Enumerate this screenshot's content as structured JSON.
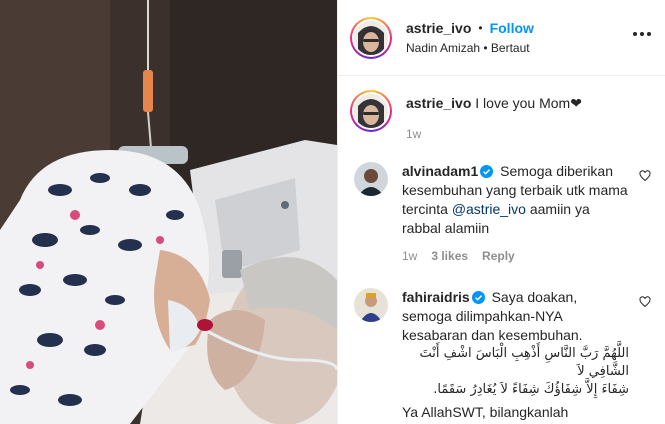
{
  "post": {
    "username": "astrie_ivo",
    "follow_label": "Follow",
    "audio": "Nadin Amizah • Bertaut",
    "caption": "I love you Mom❤",
    "caption_time": "1w"
  },
  "comments": [
    {
      "username": "alvinadam1",
      "text": "Semoga diberikan kesembuhan yang terbaik utk mama tercinta",
      "mention": "@astrie_ivo",
      "text_after": "aamiin ya rabbal alamiin",
      "time": "1w",
      "likes": "3 likes",
      "reply_label": "Reply"
    },
    {
      "username": "fahiraidris",
      "text": "Saya doakan, semoga dilimpahkan-NYA kesabaran dan kesembuhan.",
      "arabic_1": "اللَّهُمَّ رَبَّ النَّاسِ أَذْهِبِ الْبَاسَ اشْفِ أَنْتَ الشَّافِي لاَ",
      "arabic_2": "شِفَاءَ إِلاَّ شِفَاؤُكَ شِفَاءً لاَ يُغَادِرُ سَقَمًا.",
      "text_more": "Ya AllahSWT, bilangkanlah"
    }
  ],
  "colors": {
    "accent": "#0095f6",
    "mention": "#00376b",
    "muted": "#8e8e8e",
    "verified": "#0095f6"
  }
}
